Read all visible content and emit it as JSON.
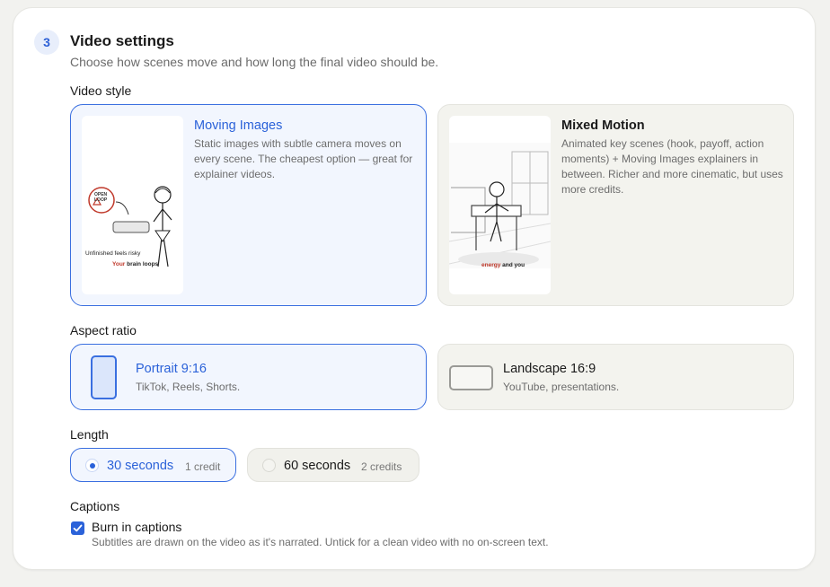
{
  "section": {
    "step_number": "3",
    "title": "Video settings",
    "subtitle": "Choose how scenes move and how long the final video should be."
  },
  "video_style": {
    "label": "Video style",
    "options": [
      {
        "name": "Moving Images",
        "description": "Static images with subtle camera moves on every scene. The cheapest option — great for explainer videos.",
        "selected": true,
        "thumb_texts": [
          "OPEN",
          "LOOP",
          "Unfinished feels risky",
          "Your",
          "brain loops"
        ]
      },
      {
        "name": "Mixed Motion",
        "description": "Animated key scenes (hook, payoff, action moments) + Moving Images explainers in between. Richer and more cinematic, but uses more credits.",
        "selected": false,
        "thumb_texts": [
          "energy",
          "and you"
        ]
      }
    ]
  },
  "aspect_ratio": {
    "label": "Aspect ratio",
    "options": [
      {
        "name": "Portrait 9:16",
        "description": "TikTok, Reels, Shorts.",
        "selected": true
      },
      {
        "name": "Landscape 16:9",
        "description": "YouTube, presentations.",
        "selected": false
      }
    ]
  },
  "length": {
    "label": "Length",
    "options": [
      {
        "label": "30 seconds",
        "credits": "1 credit",
        "selected": true
      },
      {
        "label": "60 seconds",
        "credits": "2 credits",
        "selected": false
      }
    ]
  },
  "captions": {
    "label": "Captions",
    "checkbox_label": "Burn in captions",
    "checked": true,
    "description": "Subtitles are drawn on the video as it's narrated. Untick for a clean video with no on-screen text."
  },
  "colors": {
    "accent": "#2b62d9",
    "selected_bg": "#f2f6fe",
    "unselected_bg": "#f3f3ee"
  }
}
